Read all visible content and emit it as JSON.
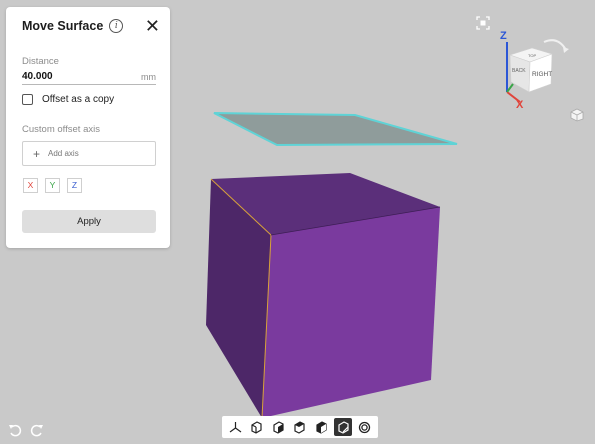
{
  "panel": {
    "title": "Move Surface",
    "info_icon": "info-icon",
    "close_label": "✕",
    "distance": {
      "label": "Distance",
      "value": "40.000",
      "unit": "mm"
    },
    "offset_copy": {
      "label": "Offset as a copy",
      "checked": false
    },
    "custom_axis": {
      "label": "Custom offset axis",
      "add_label": "Add axis",
      "axes": [
        {
          "label": "X",
          "color": "#e0443b"
        },
        {
          "label": "Y",
          "color": "#3aa548"
        },
        {
          "label": "Z",
          "color": "#3b5fd0"
        }
      ]
    },
    "apply_label": "Apply"
  },
  "viewcube": {
    "face_front": "RIGHT",
    "face_left": "BACK",
    "face_top": "TOP",
    "axis_z": "Z",
    "axis_x": "X"
  },
  "colors": {
    "viewport_bg": "#c9c9c9",
    "cube_front": "#7a3a9e",
    "cube_side": "#4d2768",
    "cube_top": "#5b2f7a",
    "surface_fill": "#8f9c9b",
    "surface_outline": "#5fd3d6",
    "edge_highlight": "#d8a23a"
  },
  "toolbar": {
    "tools": [
      {
        "name": "axis-tool-icon"
      },
      {
        "name": "box-select-icon"
      },
      {
        "name": "face-select-icon"
      },
      {
        "name": "solid-select-icon"
      },
      {
        "name": "shell-select-icon"
      },
      {
        "name": "move-surface-icon",
        "active": true
      },
      {
        "name": "offset-icon"
      }
    ]
  }
}
